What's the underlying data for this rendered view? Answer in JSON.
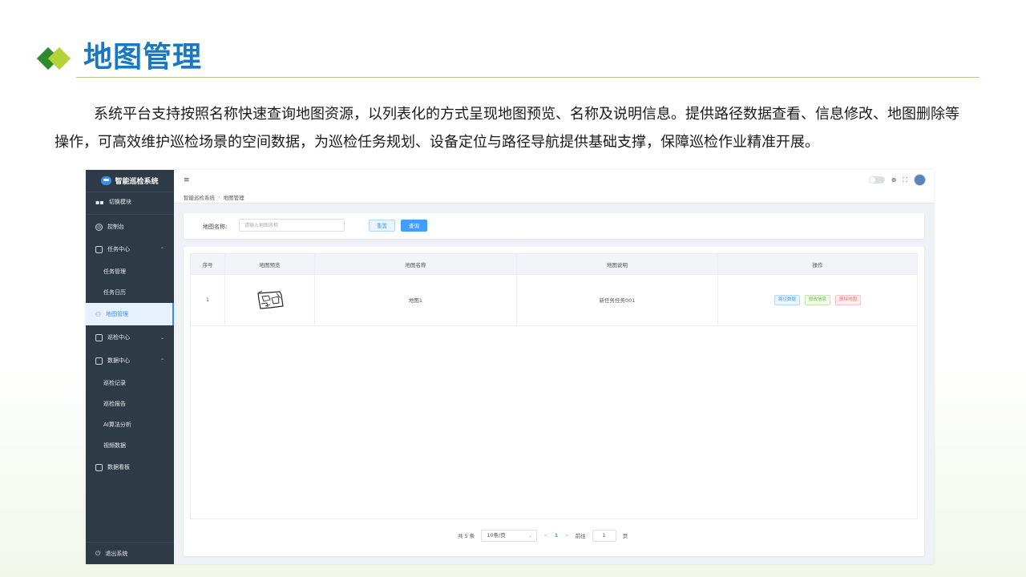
{
  "slide": {
    "title": "地图管理",
    "intro": "系统平台支持按照名称快速查询地图资源，以列表化的方式呈现地图预览、名称及说明信息。提供路径数据查看、信息修改、地图删除等操作，可高效维护巡检场景的空间数据，为巡检任务规划、设备定位与路径导航提供基础支撑，保障巡检作业精准开展。"
  },
  "app": {
    "brand": "智能巡检系统",
    "sidebar": {
      "switch_module": "切换模块",
      "items": [
        {
          "label": "控制台"
        },
        {
          "label": "任务中心",
          "arrow": "^"
        },
        {
          "label": "任务管理"
        },
        {
          "label": "任务日历"
        },
        {
          "label": "地图管理"
        },
        {
          "label": "巡检中心",
          "arrow": "v"
        },
        {
          "label": "数据中心",
          "arrow": "^"
        },
        {
          "label": "巡检记录"
        },
        {
          "label": "巡检报告"
        },
        {
          "label": "AI算法分析"
        },
        {
          "label": "视频数据"
        },
        {
          "label": "数据看板"
        }
      ],
      "exit": "退出系统"
    },
    "breadcrumb": [
      "智能巡检系统",
      "地图管理"
    ],
    "search": {
      "label": "地图名称:",
      "placeholder": "请输入地图名称",
      "reset": "重置",
      "query": "查询"
    },
    "table": {
      "columns": [
        "序号",
        "地图预览",
        "地图名称",
        "地图说明",
        "操作"
      ],
      "rows": [
        {
          "index": "1",
          "name": "地图1",
          "description": "新任务任务001"
        }
      ],
      "actions": [
        "路径数据",
        "修改信息",
        "删除地图"
      ]
    },
    "pagination": {
      "total": "共 5 条",
      "page_size": "10条/页",
      "prev": "<",
      "current": "1",
      "next": ">",
      "goto": "前往",
      "goto_value": "1",
      "page_unit": "页"
    }
  }
}
